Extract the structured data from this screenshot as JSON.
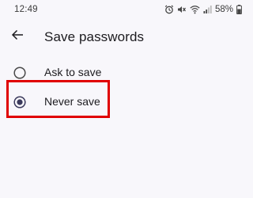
{
  "status_bar": {
    "time": "12:49",
    "battery": "58%",
    "icons": [
      "alarm-icon",
      "mute-icon",
      "wifi-icon",
      "signal-icon",
      "battery-icon"
    ]
  },
  "header": {
    "back_icon": "back-arrow-icon",
    "title": "Save passwords"
  },
  "options": [
    {
      "label": "Ask to save",
      "selected": false
    },
    {
      "label": "Never save",
      "selected": true
    }
  ],
  "colors": {
    "background": "#f8f7fb",
    "radio_selected": "#3b3a5c",
    "highlight": "#e00000"
  }
}
